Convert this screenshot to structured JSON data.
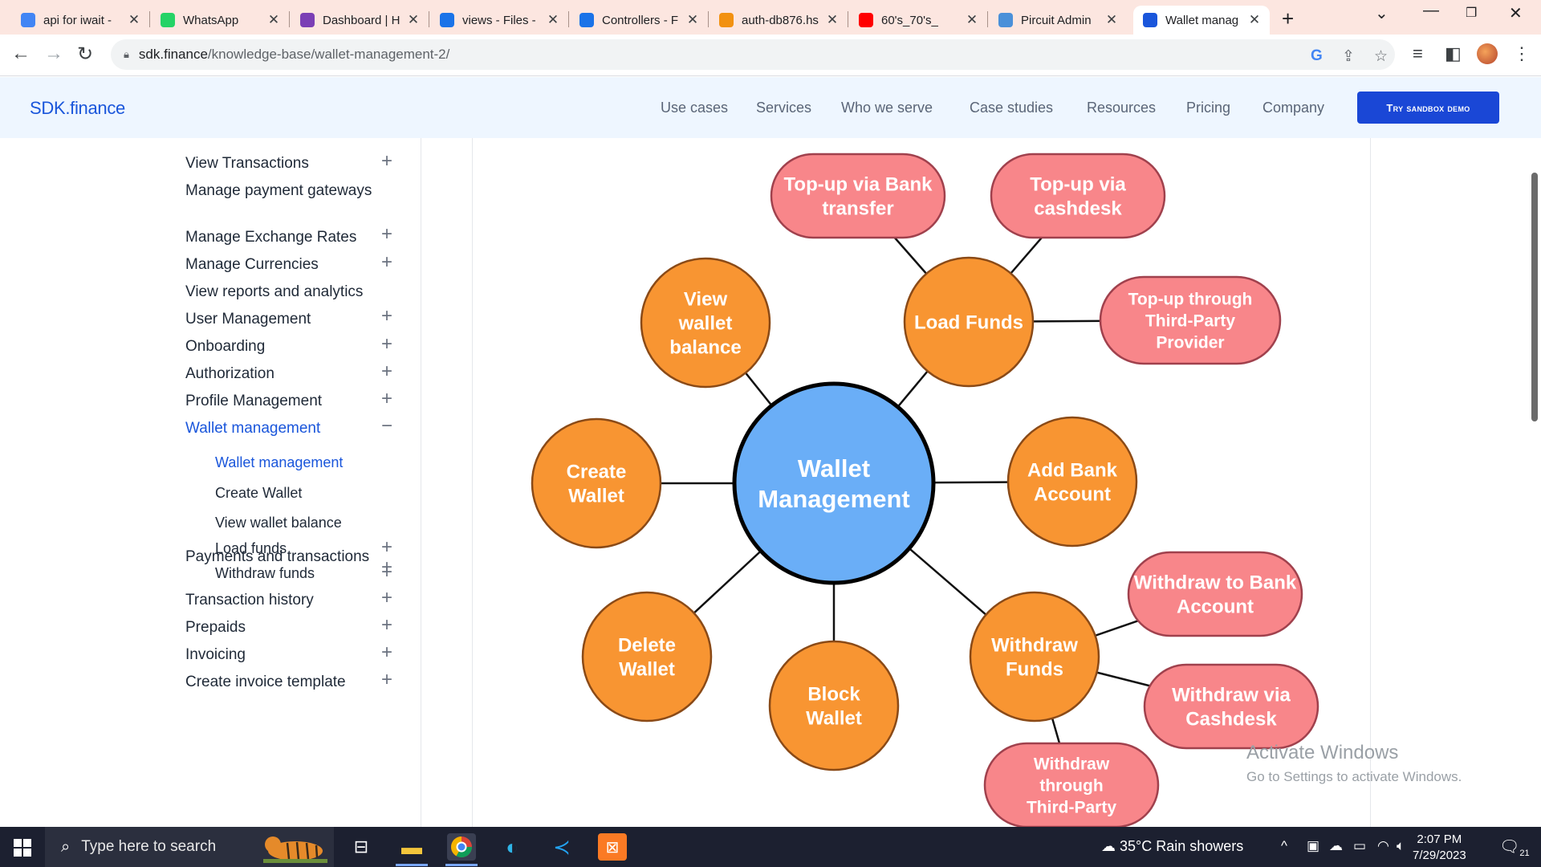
{
  "browser": {
    "tabs": [
      {
        "title": "api for iwait - ",
        "icon": "docs-icon",
        "color": "#4285f4"
      },
      {
        "title": "WhatsApp",
        "icon": "whatsapp-icon",
        "color": "#25d366"
      },
      {
        "title": "Dashboard | H",
        "icon": "dashboard-icon",
        "color": "#7b3fb5"
      },
      {
        "title": "views - Files - ",
        "icon": "files-icon",
        "color": "#1a73e8"
      },
      {
        "title": "Controllers - F",
        "icon": "files-icon",
        "color": "#1a73e8"
      },
      {
        "title": "auth-db876.hs",
        "icon": "phpmyadmin-icon",
        "color": "#f29111"
      },
      {
        "title": "60's_70's_",
        "icon": "youtube-icon",
        "color": "#ff0000"
      },
      {
        "title": "Pircuit Admin",
        "icon": "shield-icon",
        "color": "#4a90d9"
      },
      {
        "title": "Wallet manag",
        "icon": "sdk-icon",
        "color": "#1a56db",
        "active": true
      }
    ],
    "url_host": "sdk.finance",
    "url_path": "/knowledge-base/wallet-management-2/"
  },
  "site": {
    "logo": "SDK.finance",
    "nav": [
      "Use cases",
      "Services",
      "Who we serve",
      "Case studies",
      "Resources",
      "Pricing",
      "Company"
    ],
    "cta": "Try sandbox demo"
  },
  "sidebar": {
    "items": [
      {
        "label": "View Transactions",
        "toggle": "+"
      },
      {
        "label": "Manage payment gateways",
        "toggle": ""
      },
      {
        "label": "Manage Exchange Rates",
        "toggle": "+"
      },
      {
        "label": "Manage Currencies",
        "toggle": "+"
      },
      {
        "label": "View reports and analytics",
        "toggle": ""
      },
      {
        "label": "User Management",
        "toggle": "+"
      },
      {
        "label": "Onboarding",
        "toggle": "+"
      },
      {
        "label": "Authorization",
        "toggle": "+"
      },
      {
        "label": "Profile Management",
        "toggle": "+"
      },
      {
        "label": "Wallet management",
        "toggle": "−",
        "active": true
      },
      {
        "label": "Payments and transactions",
        "toggle": "+"
      },
      {
        "label": "Transaction history",
        "toggle": "+"
      },
      {
        "label": "Prepaids",
        "toggle": "+"
      },
      {
        "label": "Invoicing",
        "toggle": "+"
      },
      {
        "label": "Create invoice template",
        "toggle": "+"
      }
    ],
    "subitems": [
      {
        "label": "Wallet management",
        "toggle": "",
        "active": true
      },
      {
        "label": "Create Wallet",
        "toggle": ""
      },
      {
        "label": "View wallet balance",
        "toggle": ""
      },
      {
        "label": "Load funds",
        "toggle": "+"
      },
      {
        "label": "Withdraw funds",
        "toggle": "+"
      }
    ]
  },
  "diagram": {
    "center": "Wallet Management",
    "colors": {
      "center": "#6aaef7",
      "primary": "#f89532",
      "secondary": "#f8868a",
      "secondary_border": "#a0414d",
      "primary_border": "#8a4a17"
    },
    "primary_nodes": [
      "View wallet balance",
      "Load Funds",
      "Create Wallet",
      "Add Bank Account",
      "Delete Wallet",
      "Block Wallet",
      "Withdraw Funds"
    ],
    "secondary_nodes": [
      "Top-up via Bank transfer",
      "Top-up via cashdesk",
      "Top-up through Third-Party Provider",
      "Withdraw to Bank Account",
      "Withdraw via Cashdesk",
      "Withdraw through Third-Party"
    ]
  },
  "watermark": {
    "title": "Activate Windows",
    "subtitle": "Go to Settings to activate Windows."
  },
  "taskbar": {
    "search_placeholder": "Type here to search",
    "weather": "35°C  Rain showers",
    "time": "2:07 PM",
    "date": "7/29/2023",
    "notifications": "21"
  }
}
